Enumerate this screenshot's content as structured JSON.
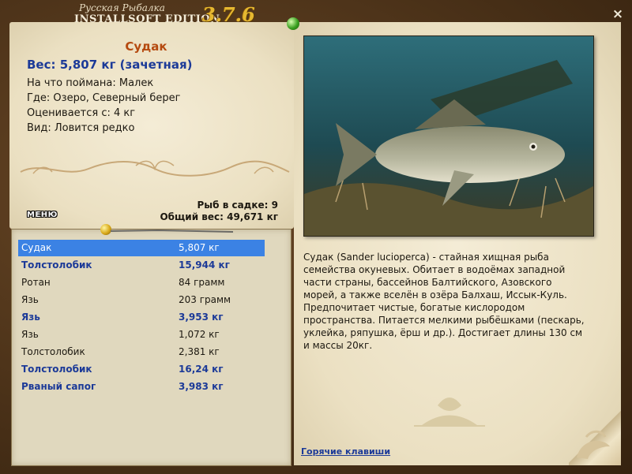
{
  "header": {
    "logo_top": "Русская Рыбалка",
    "logo_main": "INSTALLSOFT EDITION",
    "version": "3.7.6",
    "close_label": "×"
  },
  "fish": {
    "name": "Судак",
    "weight_line": "Вес: 5,807 кг (зачетная)",
    "caught_on": "На что поймана: Малек",
    "location": "Где: Озеро, Северный берег",
    "rated_from": "Оценивается с: 4 кг",
    "type": "Вид: Ловится редко"
  },
  "stats": {
    "count": "Рыб в садке: 9",
    "total_weight": "Общий вес: 49,671 кг"
  },
  "menu_label": "МЕНЮ",
  "catch_list": [
    {
      "name": "Судак",
      "weight": "5,807 кг",
      "style": "selected"
    },
    {
      "name": "Толстолобик",
      "weight": "15,944 кг",
      "style": "big"
    },
    {
      "name": "Ротан",
      "weight": "84 грамм",
      "style": "normal"
    },
    {
      "name": "Язь",
      "weight": "203 грамм",
      "style": "normal"
    },
    {
      "name": "Язь",
      "weight": "3,953 кг",
      "style": "big"
    },
    {
      "name": "Язь",
      "weight": "1,072 кг",
      "style": "normal"
    },
    {
      "name": "Толстолобик",
      "weight": "2,381 кг",
      "style": "normal"
    },
    {
      "name": "Толстолобик",
      "weight": "16,24 кг",
      "style": "big"
    },
    {
      "name": "Рваный сапог",
      "weight": "3,983 кг",
      "style": "big"
    }
  ],
  "description": {
    "lines": [
      "Судак (Sander lucioperca) - стайная хищная рыба",
      "семейства окуневых. Обитает в водоёмах западной",
      "части страны, бассейнов Балтийского, Азовского",
      "морей, а также вселён в озёра Балхаш, Иссык-Куль.",
      "Предпочитает чистые, богатые кислородом",
      "пространства. Питается мелкими рыбёшками (пескарь,",
      "уклейка, ряпушка, ёрш и др.). Достигает длины 130 см",
      "и массы 20кг."
    ]
  },
  "hotkeys_label": "Горячие клавиши",
  "colors": {
    "title": "#b54a10",
    "accent": "#1c3a98",
    "selection": "#3b82e4",
    "parchment": "#efe6cc",
    "frame": "#4a3219"
  },
  "icons": {
    "close": "close-icon",
    "pin_green": "green-pin-icon",
    "pin_gold": "gold-pin-icon"
  }
}
